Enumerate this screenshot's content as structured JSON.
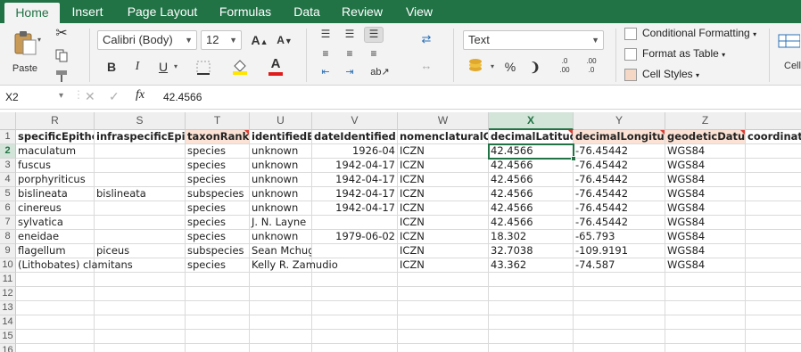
{
  "tabs": [
    "Home",
    "Insert",
    "Page Layout",
    "Formulas",
    "Data",
    "Review",
    "View"
  ],
  "ribbon": {
    "paste_label": "Paste",
    "font_name": "Calibri (Body)",
    "font_size": "12",
    "number_format": "Text",
    "conditional_formatting": "Conditional Formatting",
    "format_as_table": "Format as Table",
    "cell_styles": "Cell Styles",
    "cell_label": "Cell",
    "bold": "B",
    "italic": "I",
    "underline": "U",
    "percent": "%",
    "comma": "❩",
    "inc_decimal": ".0\n.00",
    "dec_decimal": ".00\n.0"
  },
  "formula_bar": {
    "name_box": "X2",
    "fx": "fx",
    "value": "42.4566"
  },
  "columns": [
    {
      "letter": "R",
      "header": "specificEpithet"
    },
    {
      "letter": "S",
      "header": "infraspecificEpithet"
    },
    {
      "letter": "T",
      "header": "taxonRank"
    },
    {
      "letter": "U",
      "header": "identifiedBy"
    },
    {
      "letter": "V",
      "header": "dateIdentified"
    },
    {
      "letter": "W",
      "header": "nomenclaturalCode"
    },
    {
      "letter": "X",
      "header": "decimalLatitude"
    },
    {
      "letter": "Y",
      "header": "decimalLongitude"
    },
    {
      "letter": "Z",
      "header": "geodeticDatum"
    },
    {
      "letter": "",
      "header": "coordinateU"
    }
  ],
  "rows": [
    [
      "maculatum",
      "",
      "species",
      "unknown",
      "1926-04",
      "ICZN",
      "42.4566",
      "-76.45442",
      "WGS84",
      ""
    ],
    [
      "fuscus",
      "",
      "species",
      "unknown",
      "1942-04-17",
      "ICZN",
      "42.4566",
      "-76.45442",
      "WGS84",
      ""
    ],
    [
      "porphyriticus",
      "",
      "species",
      "unknown",
      "1942-04-17",
      "ICZN",
      "42.4566",
      "-76.45442",
      "WGS84",
      ""
    ],
    [
      "bislineata",
      "bislineata",
      "subspecies",
      "unknown",
      "1942-04-17",
      "ICZN",
      "42.4566",
      "-76.45442",
      "WGS84",
      ""
    ],
    [
      "cinereus",
      "",
      "species",
      "unknown",
      "1942-04-17",
      "ICZN",
      "42.4566",
      "-76.45442",
      "WGS84",
      ""
    ],
    [
      "sylvatica",
      "",
      "species",
      "J. N. Layne",
      "",
      "ICZN",
      "42.4566",
      "-76.45442",
      "WGS84",
      ""
    ],
    [
      "eneidae",
      "",
      "species",
      "unknown",
      "1979-06-02",
      "ICZN",
      "18.302",
      "-65.793",
      "WGS84",
      ""
    ],
    [
      "flagellum",
      "piceus",
      "subspecies",
      "Sean Mchugh",
      "",
      "ICZN",
      "32.7038",
      "-109.9191",
      "WGS84",
      ""
    ],
    [
      "(Lithobates) clamitans",
      "",
      "species",
      "Kelly R. Zamudio",
      "",
      "ICZN",
      "43.362",
      "-74.587",
      "WGS84",
      ""
    ],
    [
      "",
      "",
      "",
      "",
      "",
      "",
      "",
      "",
      "",
      ""
    ],
    [
      "",
      "",
      "",
      "",
      "",
      "",
      "",
      "",
      "",
      ""
    ],
    [
      "",
      "",
      "",
      "",
      "",
      "",
      "",
      "",
      "",
      ""
    ],
    [
      "",
      "",
      "",
      "",
      "",
      "",
      "",
      "",
      "",
      ""
    ],
    [
      "",
      "",
      "",
      "",
      "",
      "",
      "",
      "",
      "",
      ""
    ],
    [
      "",
      "",
      "",
      "",
      "",
      "",
      "",
      "",
      "",
      ""
    ]
  ],
  "row_numbers": [
    "1",
    "2",
    "3",
    "4",
    "5",
    "6",
    "7",
    "8",
    "9",
    "10",
    "11",
    "12",
    "13",
    "14",
    "15",
    "16"
  ],
  "colors": {
    "accent": "#217346",
    "header_highlight": "#fbe2d5",
    "comment_marker": "#e03c31"
  }
}
